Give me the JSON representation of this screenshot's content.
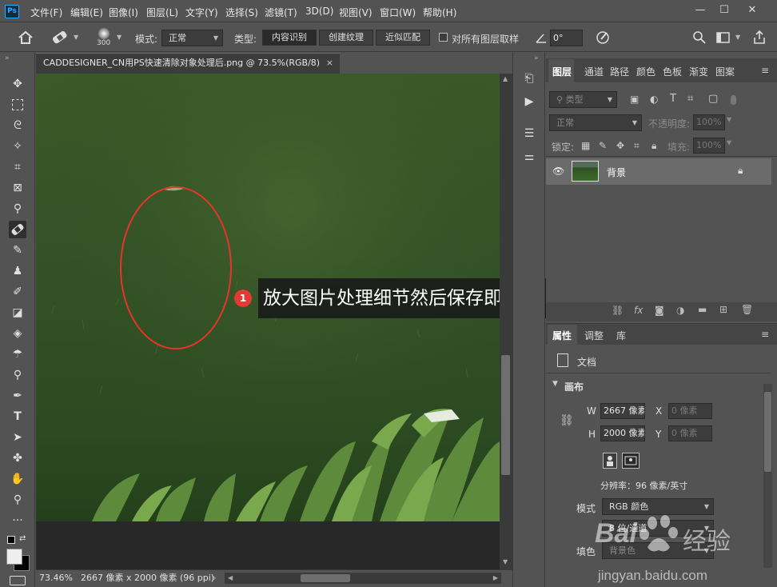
{
  "app": {
    "logo": "Ps"
  },
  "menu": [
    "文件(F)",
    "编辑(E)",
    "图像(I)",
    "图层(L)",
    "文字(Y)",
    "选择(S)",
    "滤镜(T)",
    "3D(D)",
    "视图(V)",
    "窗口(W)",
    "帮助(H)"
  ],
  "window_controls": {
    "minimize": "—",
    "maximize": "☐",
    "close": "✕"
  },
  "options": {
    "brush_size": "300",
    "mode_label": "模式:",
    "mode_value": "正常",
    "type_label": "类型:",
    "type_buttons": [
      "内容识别",
      "创建纹理",
      "近似匹配"
    ],
    "sample_all_label": "对所有图层取样",
    "angle_value": "0°"
  },
  "document": {
    "tab_title": "CADDESIGNER_CN用PS快速清除对象处理后.png @ 73.5%(RGB/8)",
    "tab_close": "×"
  },
  "status": {
    "zoom": "73.46%",
    "info": "2667 像素 x 2000 像素 (96 ppi)",
    "arrow": "›"
  },
  "layers_panel": {
    "tabs": [
      "图层",
      "通道",
      "路径",
      "颜色",
      "色板",
      "渐变",
      "图案"
    ],
    "filter_placeholder": "类型",
    "blend_mode": "正常",
    "opacity_label": "不透明度:",
    "opacity_value": "100%",
    "lock_label": "锁定:",
    "fill_label": "填充:",
    "fill_value": "100%",
    "layer_name": "背景"
  },
  "properties_panel": {
    "tabs": [
      "属性",
      "调整",
      "库"
    ],
    "doc_label": "文档",
    "section": "画布",
    "w_label": "W",
    "w_value": "2667 像素",
    "x_label": "X",
    "x_placeholder": "0 像素",
    "h_label": "H",
    "h_value": "2000 像素",
    "y_label": "Y",
    "y_placeholder": "0 像素",
    "resolution": "分辨率：96 像素/英寸",
    "mode_label": "模式",
    "mode_value": "RGB 颜色",
    "bitdepth_value": "8 位/通道",
    "fill_label": "填色",
    "fill_value": "背景色"
  },
  "callout": {
    "number": "1",
    "text": "放大图片处理细节然后保存即可。"
  },
  "watermark": {
    "brand": "Bai",
    "brand2": "经验",
    "url": "jingyan.baidu.com"
  },
  "colors": {
    "accent": "#31a8ff",
    "callout_marker": "#e53935",
    "ellipse": "#e8342a"
  }
}
